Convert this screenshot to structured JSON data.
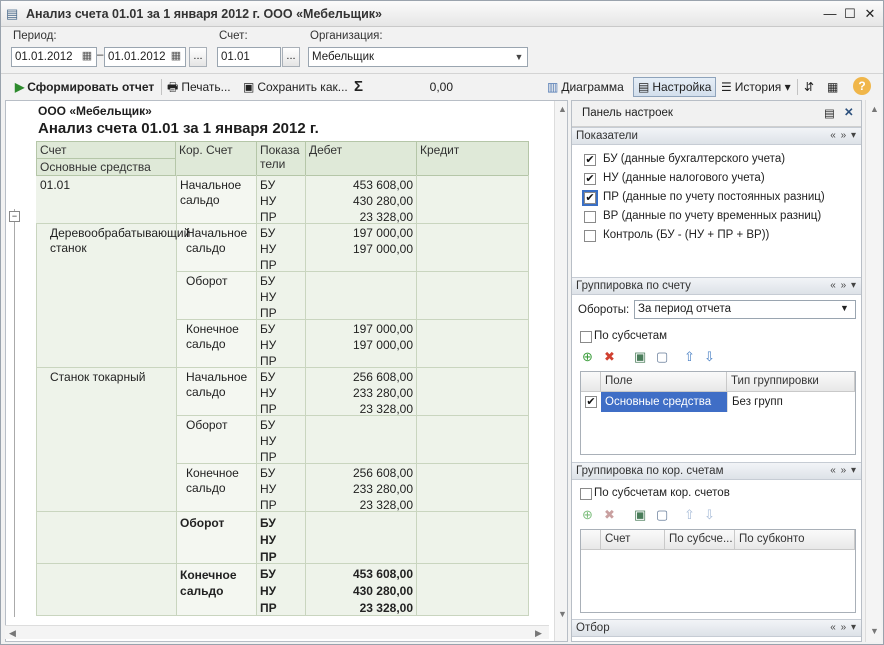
{
  "window": {
    "title": "Анализ счета 01.01 за 1 января 2012 г. ООО «Мебельщик»",
    "minimize": "—",
    "maximize": "☐",
    "close": "✕"
  },
  "params": {
    "period_label": "Период:",
    "period_from": "01.01.2012",
    "period_sep": "–",
    "period_to": "01.01.2012",
    "period_more": "...",
    "account_label": "Счет:",
    "account_value": "01.01",
    "org_label": "Организация:",
    "org_value": "Мебельщик"
  },
  "toolbar": {
    "generate": "Сформировать отчет",
    "print": "Печать...",
    "save": "Сохранить как...",
    "sigma": "Σ",
    "sum": "0,00",
    "chart": "Диаграмма",
    "settings": "Настройка",
    "history": "История ▾",
    "help": "?"
  },
  "report": {
    "org": "ООО «Мебельщик»",
    "title": "Анализ счета 01.01 за 1 января 2012 г.",
    "headers": {
      "account": "Счет",
      "fixed_assets": "Основные средства",
      "corr_account": "Кор. Счет",
      "indicators": "Показа тели",
      "debit": "Дебет",
      "credit": "Кредит"
    },
    "account_code": "01.01",
    "asset1": "Деревообрабатывающий станок",
    "asset2": "Станок токарный",
    "labels": {
      "opening": "Начальное сальдо",
      "turnover": "Оборот",
      "closing": "Конечное сальдо"
    },
    "ind": [
      "БУ",
      "НУ",
      "ПР"
    ],
    "values": {
      "total_open": [
        "453 608,00",
        "430 280,00",
        "23 328,00"
      ],
      "a1_open": [
        "197 000,00",
        "197 000,00",
        ""
      ],
      "a1_close": [
        "197 000,00",
        "197 000,00",
        ""
      ],
      "a2_open": [
        "256 608,00",
        "233 280,00",
        "23 328,00"
      ],
      "a2_close": [
        "256 608,00",
        "233 280,00",
        "23 328,00"
      ],
      "total_close": [
        "453 608,00",
        "430 280,00",
        "23 328,00"
      ]
    }
  },
  "panel": {
    "title": "Панель настроек",
    "sect_indicators": "Показатели",
    "indicators": [
      {
        "label": "БУ (данные бухгалтерского учета)",
        "checked": "✔"
      },
      {
        "label": "НУ (данные налогового учета)",
        "checked": "✔"
      },
      {
        "label": "ПР (данные по учету постоянных разниц)",
        "checked": "✔"
      },
      {
        "label": "ВР (данные по учету временных разниц)",
        "checked": ""
      },
      {
        "label": "Контроль (БУ - (НУ + ПР + ВР))",
        "checked": ""
      }
    ],
    "sect_group_acc": "Группировка по счету",
    "turnovers_label": "Обороты:",
    "turnovers_value": "За период отчета",
    "by_subaccounts": "По субсчетам",
    "grid1_col1": "Поле",
    "grid1_col2": "Тип группировки",
    "grid1_row_field": "Основные средства",
    "grid1_row_type": "Без групп",
    "grid1_row_check": "✔",
    "sect_group_corr": "Группировка по кор. счетам",
    "by_corr_subaccounts": "По субсчетам кор. счетов",
    "grid2_col1": "Счет",
    "grid2_col2": "По субсче...",
    "grid2_col3": "По субконто",
    "sect_filter": "Отбор",
    "sect_controls": "« » ▾"
  }
}
